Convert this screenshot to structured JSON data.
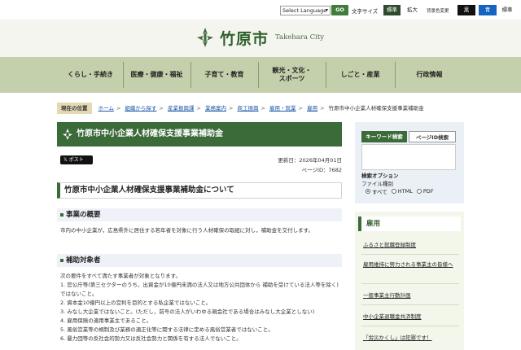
{
  "utility": {
    "language_select": "Select Language",
    "go_label": "GO",
    "font_size_label": "文字サイズ",
    "font_standard": "標準",
    "font_enlarge": "拡大",
    "bg_color_label": "背景色変更",
    "bg_black": "黒",
    "bg_blue": "青",
    "bg_standard": "標準"
  },
  "header": {
    "title": "竹原市",
    "subtitle": "Takehara City"
  },
  "nav": {
    "items": [
      {
        "line1": "くらし・手続き",
        "line2": ""
      },
      {
        "line1": "医療・健康・福祉",
        "line2": ""
      },
      {
        "line1": "子育て・教育",
        "line2": ""
      },
      {
        "line1": "観光・文化・",
        "line2": "スポーツ"
      },
      {
        "line1": "しごと・産業",
        "line2": ""
      },
      {
        "line1": "行政情報",
        "line2": ""
      }
    ]
  },
  "breadcrumb": {
    "here_label": "現在の位置",
    "items": [
      "ホーム",
      "組織から探す",
      "産業振興課",
      "業務案内",
      "商工振興",
      "雇用・就業",
      "雇用"
    ],
    "current": "竹原市中小企業人材確保支援事業補助金"
  },
  "main": {
    "page_title": "竹原市中小企業人材確保支援事業補助金",
    "share_label": "ポスト",
    "updated": "更新日：2026年04月01日",
    "page_id": "ページID：7682",
    "section_title": "竹原市中小企業人材確保支援事業補助金について",
    "overview_heading": "事業の概要",
    "overview_text": "市内の中小企業が，広島県外に居住する若年者を対象に行う人材確保の取組に対し，補助金を交付します。",
    "eligible_heading": "補助対象者",
    "eligible_intro": "次の要件をすべて満たす事業者が対象となります。",
    "eligible_items": [
      "1. 官公庁等(第三セクターのうち，出資金が10億円未満の法人又は地方公共団体から 補助を受けている法人等を除く)ではないこと。",
      "2. 資本金10億円以上の営利を目的とする私企業ではないこと。",
      "3. みなし大企業ではないこと。(ただし，前号の法人がいわゆる親会社である場合はみなし大企業としない)",
      "4. 雇用保険の適用事業主であること。",
      "5. 風俗営業等の規制及び業務の適正化等に関する法律に定める風俗営業者ではないこと。",
      "6. 暴力団等の反社会的勢力又は反社会勢力と関係を有する法人でないこと。"
    ]
  },
  "sidebar": {
    "tab_keyword": "キーワード検索",
    "tab_pageid": "ページID検索",
    "search_option_label": "検索オプション",
    "file_type_label": "ファイル種別",
    "radio_all": "すべて",
    "radio_html": "HTML",
    "radio_pdf": "PDF",
    "category_title": "雇用",
    "category_links": [
      "ふるさと就職登録制度",
      "雇用維持に努力される事業主の皆様へ",
      "一般事業主行動計画",
      "中小企業退職金共済制度",
      "「労災かくし」は犯罪です！"
    ]
  },
  "colors": {
    "brand_green": "#3c6b3a",
    "nav_bg": "#c4d0ab",
    "header_bg": "#f5f5ef",
    "link_blue": "#1a56a8"
  }
}
